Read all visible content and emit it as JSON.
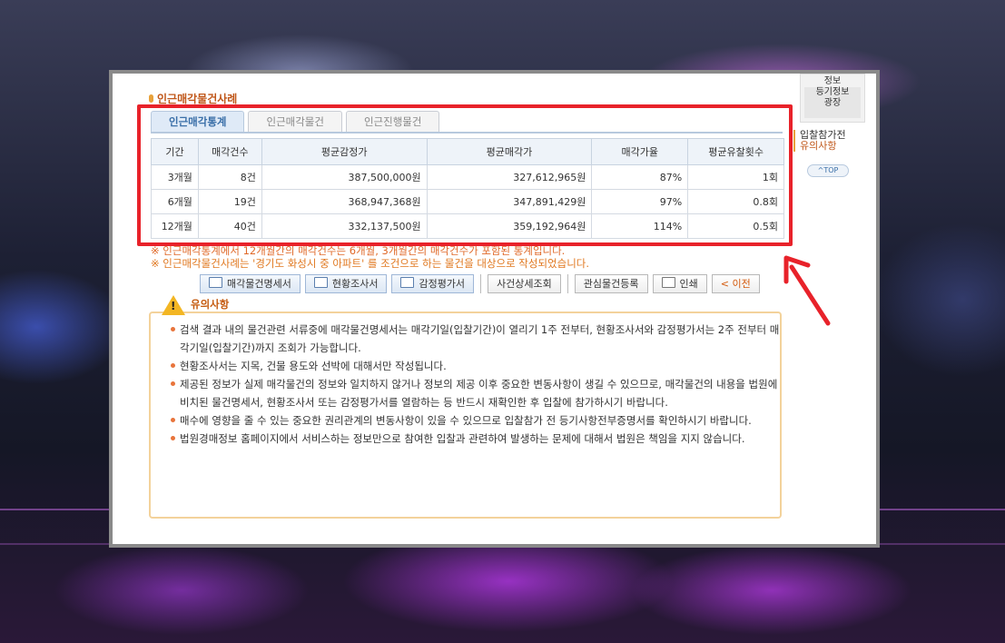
{
  "section_title": "인근매각물건사례",
  "tabs": [
    {
      "label": "인근매각통계",
      "active": true
    },
    {
      "label": "인근매각물건",
      "active": false
    },
    {
      "label": "인근진행물건",
      "active": false
    }
  ],
  "table": {
    "headers": [
      "기간",
      "매각건수",
      "평균감정가",
      "평균매각가",
      "매각가율",
      "평균유찰횟수"
    ],
    "rows": [
      [
        "3개월",
        "8건",
        "387,500,000원",
        "327,612,965원",
        "87%",
        "1회"
      ],
      [
        "6개월",
        "19건",
        "368,947,368원",
        "347,891,429원",
        "97%",
        "0.8회"
      ],
      [
        "12개월",
        "40건",
        "332,137,500원",
        "359,192,964원",
        "114%",
        "0.5회"
      ]
    ]
  },
  "notes": [
    "※ 인근매각통계에서 12개월간의 매각건수는 6개월, 3개월간의 매각건수가 포함된 통계입니다.",
    "※ 인근매각물건사례는 '경기도 화성시 중 아파트' 를 조건으로 하는 물건을 대상으로 작성되었습니다."
  ],
  "buttons": {
    "sale_statement": "매각물건명세서",
    "status_report": "현황조사서",
    "appraisal": "감정평가서",
    "time_detail": "사건상세조회",
    "interest_register": "관심물건등록",
    "print": "인쇄",
    "prev": "< 이전"
  },
  "warning": {
    "title": "유의사항",
    "items": [
      "검색 결과 내의 물건관련 서류중에 매각물건명세서는 매각기일(입찰기간)이 열리기 1주 전부터, 현황조사서와 감정평가서는 2주 전부터 매각기일(입찰기간)까지 조회가 가능합니다.",
      "현황조사서는 지목, 건물 용도와 선박에 대해서만 작성됩니다.",
      "제공된 정보가 실제 매각물건의 정보와 일치하지 않거나 정보의 제공 이후 중요한 변동사항이 생길 수 있으므로, 매각물건의 내용을 법원에 비치된 물건명세서, 현황조사서 또는 감정평가서를 열람하는 등 반드시 재확인한 후 입찰에 참가하시기 바랍니다.",
      "매수에 영향을 줄 수 있는 중요한 권리관계의 변동사항이 있을 수 있으므로 입찰참가 전 등기사항전부증명서를 확인하시기 바랍니다.",
      "법원경매정보 홈페이지에서 서비스하는 정보만으로 참여한 입찰과 관련하여 발생하는 문제에 대해서 법원은 책임을 지지 않습니다."
    ]
  },
  "side": {
    "box_line1": "정보",
    "box_line2": "등기정보",
    "box_line3": "광장",
    "notice_line1": "입찰참가전",
    "notice_line2": "유의사항",
    "top": "^TOP"
  },
  "colors": {
    "highlight": "#e8222a",
    "accent": "#c0571a"
  }
}
